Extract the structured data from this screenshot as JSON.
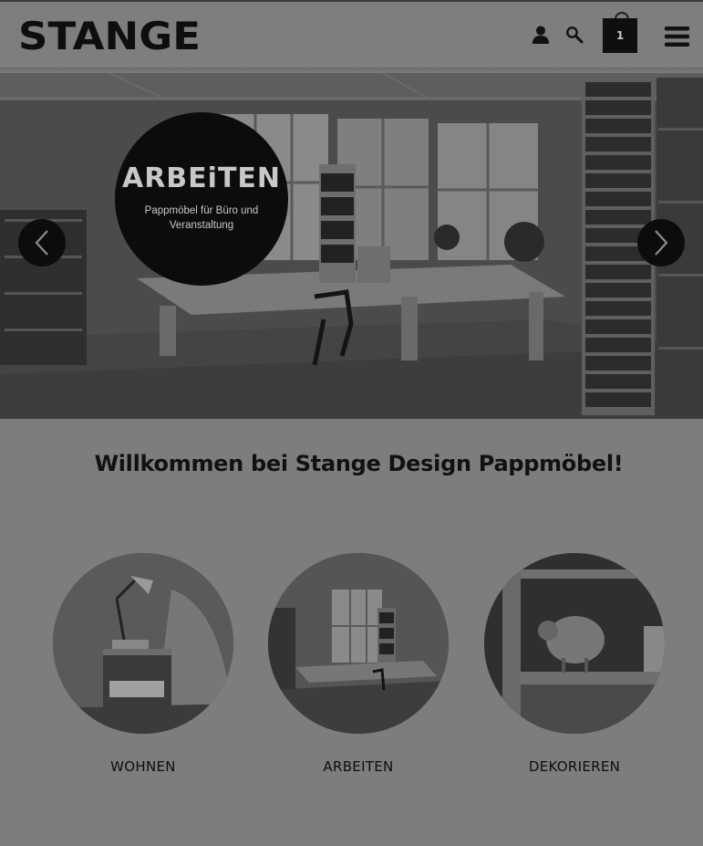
{
  "header": {
    "logo_text": "STANGE",
    "cart_count": "1"
  },
  "hero": {
    "badge_title": "ARBEiTEN",
    "badge_subtitle": "Pappmöbel für Büro und Veranstaltung"
  },
  "main": {
    "welcome_title": "Willkommen bei Stange Design Pappmöbel!",
    "categories": [
      {
        "label": "WOHNEN"
      },
      {
        "label": "ARBEITEN"
      },
      {
        "label": "DEKORIEREN"
      }
    ]
  },
  "colors": {
    "page_bg": "#7d7d7d",
    "dark": "#0c0c0c",
    "text": "#111111"
  }
}
